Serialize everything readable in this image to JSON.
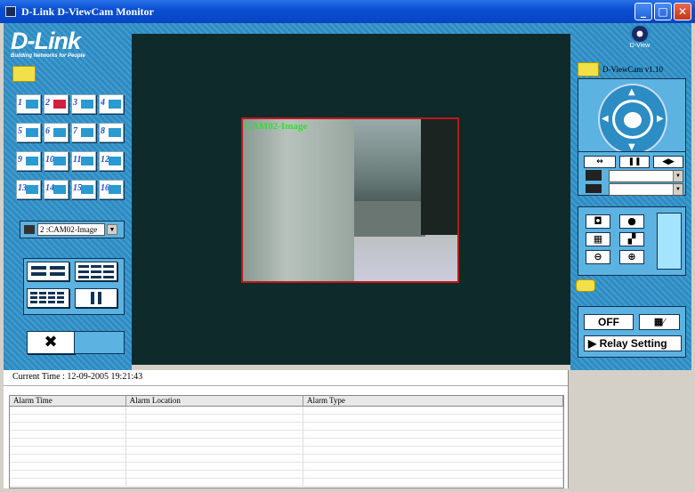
{
  "window": {
    "title": "D-Link D-ViewCam Monitor"
  },
  "logo": {
    "brand": "D-Link",
    "tagline": "Building Networks for People"
  },
  "camera_buttons": [
    "1",
    "2",
    "3",
    "4",
    "5",
    "6",
    "7",
    "8",
    "9",
    "10",
    "11",
    "12",
    "13",
    "14",
    "15",
    "16"
  ],
  "active_camera": 2,
  "camera_select": {
    "value": "2 :CAM02-Image"
  },
  "video": {
    "camera_label": "CAM02-Image"
  },
  "right_panel": {
    "product": "D-View",
    "version": "D-ViewCam v1.10"
  },
  "relay": {
    "off_label": "OFF",
    "relay_label": "Relay Setting"
  },
  "status": {
    "current_time": "Current Time : 12-09-2005 19:21:43"
  },
  "alarm_table": {
    "columns": [
      "Alarm Time",
      "Alarm Location",
      "Alarm Type"
    ]
  },
  "colors": {
    "panel": "#2c8cc4",
    "video_bg": "#0e2a2a",
    "active_cam": "#d02040",
    "label": "#30e030"
  }
}
